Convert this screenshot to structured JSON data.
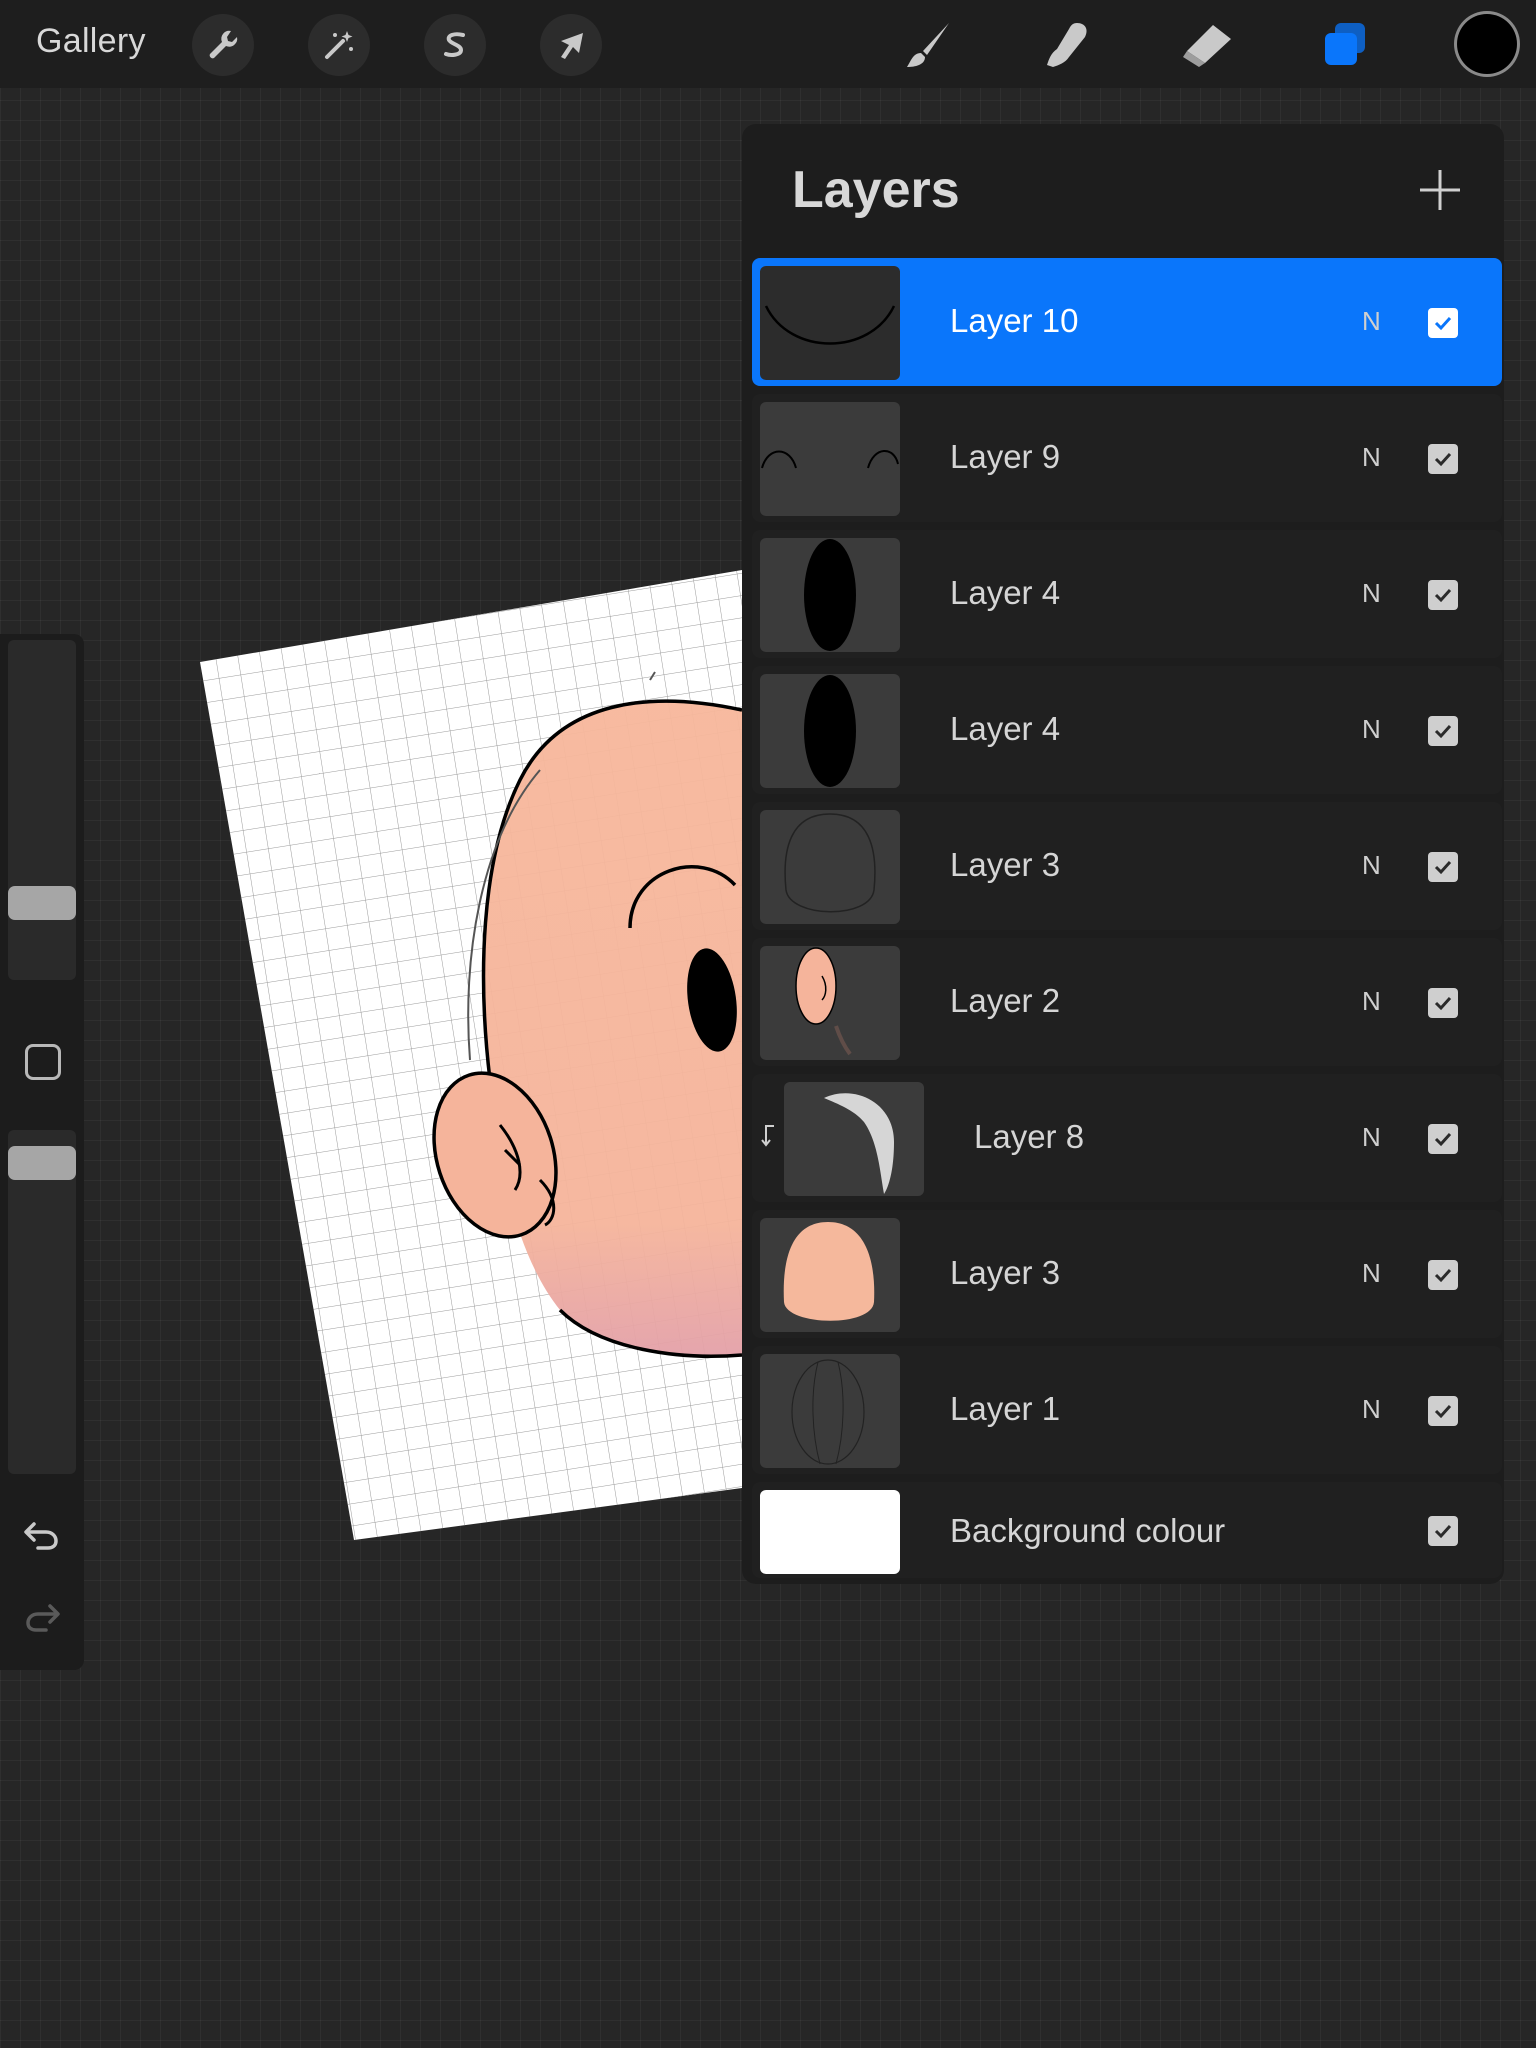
{
  "toolbar": {
    "gallery_label": "Gallery",
    "left_tools": [
      {
        "icon": "wrench-icon",
        "name": "actions"
      },
      {
        "icon": "magic-wand-icon",
        "name": "adjustments"
      },
      {
        "icon": "selection-s-icon",
        "name": "selection"
      },
      {
        "icon": "arrow-cursor-icon",
        "name": "transform"
      }
    ],
    "right_tools": [
      {
        "icon": "brush-icon",
        "name": "paint"
      },
      {
        "icon": "smudge-icon",
        "name": "smudge"
      },
      {
        "icon": "eraser-icon",
        "name": "erase"
      },
      {
        "icon": "layers-icon",
        "name": "layers",
        "active": true
      }
    ],
    "active_color": "#000000",
    "accent": "#0a76fb"
  },
  "sidebar": {
    "icons": [
      "modify-square-icon",
      "undo-icon",
      "redo-icon"
    ]
  },
  "layers_panel": {
    "title": "Layers",
    "add_icon": "plus-icon",
    "layers": [
      {
        "name": "Layer 10",
        "blend": "N",
        "visible": true,
        "selected": true
      },
      {
        "name": "Layer 9",
        "blend": "N",
        "visible": true
      },
      {
        "name": "Layer 4",
        "blend": "N",
        "visible": true
      },
      {
        "name": "Layer 4",
        "blend": "N",
        "visible": true
      },
      {
        "name": "Layer 3",
        "blend": "N",
        "visible": true
      },
      {
        "name": "Layer 2",
        "blend": "N",
        "visible": true
      },
      {
        "name": "Layer 8",
        "blend": "N",
        "visible": true,
        "clipping_mask": true
      },
      {
        "name": "Layer 3",
        "blend": "N",
        "visible": true
      },
      {
        "name": "Layer 1",
        "blend": "N",
        "visible": true
      }
    ],
    "background": {
      "name": "Background colour",
      "color": "#ffffff",
      "visible": true
    }
  }
}
